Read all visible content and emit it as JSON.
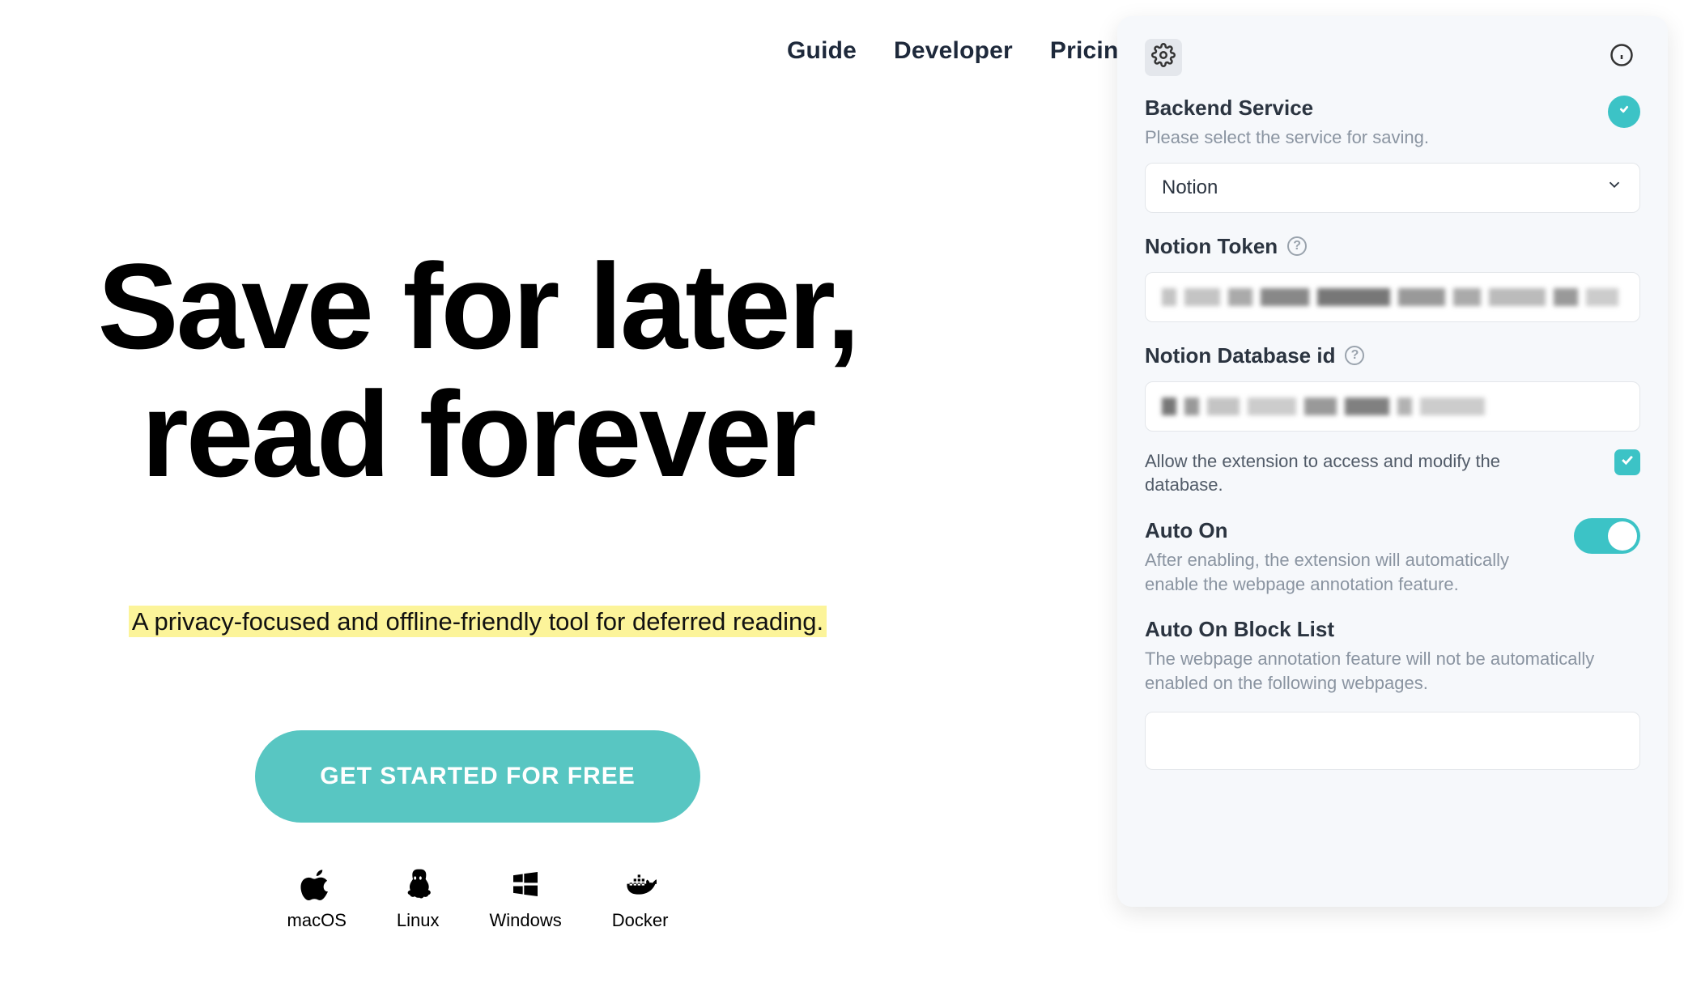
{
  "nav": {
    "items": [
      "Guide",
      "Developer",
      "Pricing"
    ]
  },
  "hero": {
    "title_line1": "Save for later,",
    "title_line2": "read forever",
    "tagline": "A privacy-focused and offline-friendly tool for deferred reading.",
    "cta": "GET STARTED FOR FREE"
  },
  "platforms": [
    {
      "label": "macOS",
      "icon": "apple-icon"
    },
    {
      "label": "Linux",
      "icon": "linux-icon"
    },
    {
      "label": "Windows",
      "icon": "windows-icon"
    },
    {
      "label": "Docker",
      "icon": "docker-icon"
    }
  ],
  "panel": {
    "backend": {
      "title": "Backend Service",
      "desc": "Please select the service for saving.",
      "selected": "Notion"
    },
    "token": {
      "title": "Notion Token"
    },
    "database": {
      "title": "Notion Database id"
    },
    "allow": {
      "label": "Allow the extension to access and modify the database.",
      "checked": true
    },
    "autoOn": {
      "title": "Auto On",
      "desc": "After enabling, the extension will automatically enable the webpage annotation feature.",
      "enabled": true
    },
    "blockList": {
      "title": "Auto On Block List",
      "desc": "The webpage annotation feature will not be automatically enabled on the following webpages."
    }
  },
  "colors": {
    "accent": "#3cc3c6",
    "highlight": "#fcf49a"
  }
}
